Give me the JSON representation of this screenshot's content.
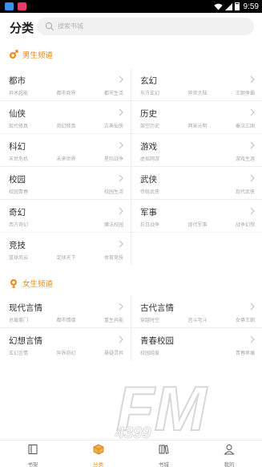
{
  "status_bar": {
    "time": "9:59"
  },
  "header": {
    "title": "分类",
    "search_placeholder": "搜索书城"
  },
  "male_section": {
    "title": "男生频道",
    "categories": [
      {
        "title": "都市",
        "subs": [
          "异术超能",
          "都市商界",
          "都市生活"
        ]
      },
      {
        "title": "玄幻",
        "subs": [
          "东方玄幻",
          "异世大陆",
          "王朝争霸"
        ]
      },
      {
        "title": "仙侠",
        "subs": [
          "现代修真",
          "奇幻修真",
          "古典仙侠"
        ]
      },
      {
        "title": "历史",
        "subs": [
          "架空历史",
          "两宋元明",
          "秦汉三国"
        ]
      },
      {
        "title": "科幻",
        "subs": [
          "末世危机",
          "未来世界",
          "星际战争"
        ]
      },
      {
        "title": "游戏",
        "subs": [
          "虚拟网游",
          "游戏生涯"
        ]
      },
      {
        "title": "校园",
        "subs": [
          "校园青春",
          "校园生活"
        ]
      },
      {
        "title": "武侠",
        "subs": [
          "传统武侠",
          "现代武侠"
        ]
      },
      {
        "title": "奇幻",
        "subs": [
          "西方奇幻",
          "魔法校园"
        ]
      },
      {
        "title": "军事",
        "subs": [
          "抗日战争",
          "现代军事",
          "战争幻想"
        ]
      },
      {
        "title": "竞技",
        "subs": [
          "篮球风云",
          "足球天下",
          "体育竞技"
        ]
      }
    ]
  },
  "female_section": {
    "title": "女生频道",
    "categories": [
      {
        "title": "现代言情",
        "subs": [
          "总裁豪门",
          "都市情缘",
          "重生异能"
        ]
      },
      {
        "title": "古代言情",
        "subs": [
          "穿越时空",
          "宫斗宅斗",
          "女尊王朝"
        ]
      },
      {
        "title": "幻想言情",
        "subs": [
          "玄幻言情",
          "异界奇幻",
          "悬疑灵异"
        ]
      },
      {
        "title": "青春校园",
        "subs": [
          "校园纯爱",
          "青春疼痛"
        ]
      }
    ]
  },
  "watermark": {
    "text": "FM",
    "number": "4399"
  },
  "bottom_nav": [
    {
      "label": "书架"
    },
    {
      "label": "分类"
    },
    {
      "label": "书城"
    },
    {
      "label": "我的"
    }
  ],
  "colors": {
    "accent": "#f08a1c",
    "male_icon": "#f08a1c",
    "female_icon": "#f08a1c"
  }
}
